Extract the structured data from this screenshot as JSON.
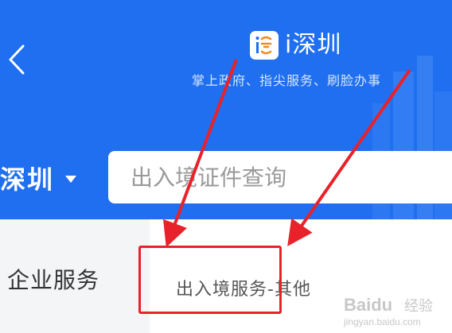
{
  "header": {
    "back_icon": "chevron-left-icon",
    "app_name": "i深圳",
    "logo_icon": "i-shenzhen-logo-icon",
    "tagline": "掌上政府、指尖服务、刷脸办事",
    "background_color": "#1f6ff0"
  },
  "city_selector": {
    "city": "深圳",
    "dropdown_icon": "caret-down-icon"
  },
  "search": {
    "placeholder": "出入境证件查询"
  },
  "sidebar": {
    "items": [
      {
        "label": "企业服务"
      }
    ]
  },
  "content": {
    "items": [
      {
        "label": "出入境服务-其他"
      }
    ]
  },
  "annotation": {
    "highlight_color": "#e8222a"
  },
  "watermark": {
    "brand": "Baidu",
    "brand_cn": "经验",
    "url": "jingyan.baidu.com"
  }
}
